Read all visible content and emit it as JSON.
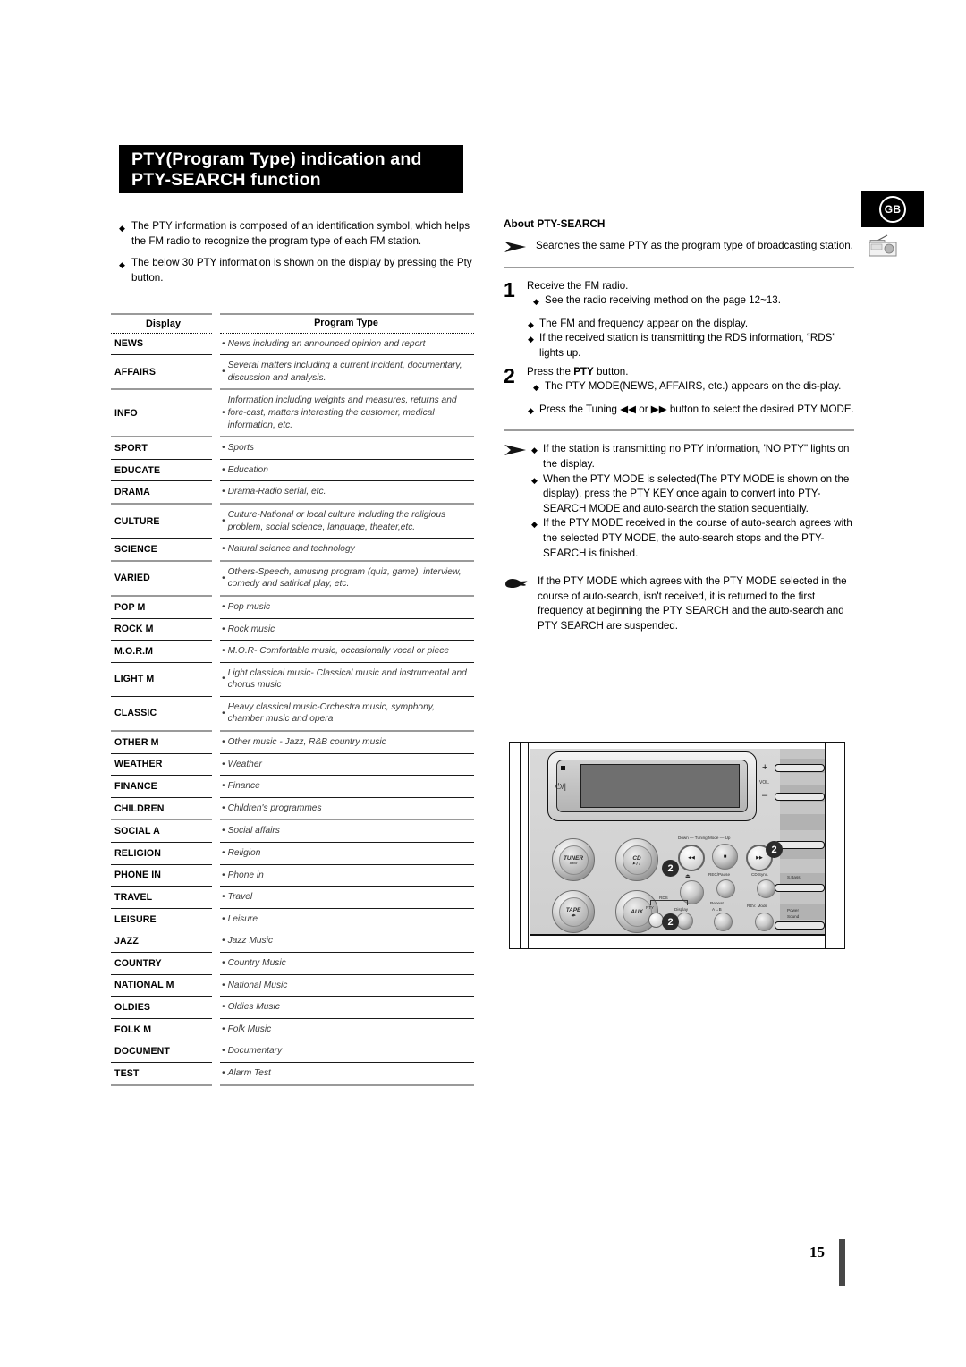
{
  "title": {
    "line1": "PTY(Program Type) indication and",
    "line2": "PTY-SEARCH function"
  },
  "badge": {
    "region": "GB"
  },
  "intro": {
    "bullet1": "The PTY information is composed of an identification symbol, which helps the FM radio to recognize the program type of each FM station.",
    "bullet2": "The below 30 PTY information is shown on the display by pressing the Pty button."
  },
  "table": {
    "headers": {
      "display": "Display",
      "program_type": "Program Type"
    },
    "rows": [
      {
        "display": "NEWS",
        "program": "News including an announced opinion and report"
      },
      {
        "display": "AFFAIRS",
        "program": "Several matters including a current incident, documentary, discussion and analysis."
      },
      {
        "display": "INFO",
        "program": "Information including weights and measures, returns and fore-cast, matters interesting the customer, medical information, etc."
      },
      {
        "display": "SPORT",
        "program": "Sports"
      },
      {
        "display": "EDUCATE",
        "program": "Education"
      },
      {
        "display": "DRAMA",
        "program": "Drama-Radio serial, etc."
      },
      {
        "display": "CULTURE",
        "program": "Culture-National or local culture including the religious problem, social science, language, theater,etc."
      },
      {
        "display": "SCIENCE",
        "program": "Natural science and technology"
      },
      {
        "display": "VARIED",
        "program": "Others-Speech, amusing program (quiz, game), interview, comedy and satirical play, etc."
      },
      {
        "display": "POP M",
        "program": "Pop music"
      },
      {
        "display": "ROCK M",
        "program": "Rock music"
      },
      {
        "display": "M.O.R.M",
        "program": "M.O.R- Comfortable music, occasionally vocal or piece"
      },
      {
        "display": "LIGHT M",
        "program": "Light classical music- Classical music and instrumental and chorus music"
      },
      {
        "display": "CLASSIC",
        "program": "Heavy classical  music-Orchestra music, symphony, chamber music and opera"
      },
      {
        "display": "OTHER M",
        "program": "Other music - Jazz, R&B country music"
      },
      {
        "display": "WEATHER",
        "program": "Weather"
      },
      {
        "display": "FINANCE",
        "program": "Finance"
      },
      {
        "display": "CHILDREN",
        "program": "Children's programmes"
      },
      {
        "display": "SOCIAL  A",
        "program": "Social affairs"
      },
      {
        "display": "RELIGION",
        "program": "Religion"
      },
      {
        "display": "PHONE IN",
        "program": "Phone in"
      },
      {
        "display": "TRAVEL",
        "program": "Travel"
      },
      {
        "display": "LEISURE",
        "program": "Leisure"
      },
      {
        "display": "JAZZ",
        "program": "Jazz Music"
      },
      {
        "display": "COUNTRY",
        "program": "Country Music"
      },
      {
        "display": "NATIONAL M",
        "program": "National Music"
      },
      {
        "display": "OLDIES",
        "program": "Oldies Music"
      },
      {
        "display": "FOLK M",
        "program": "Folk Music"
      },
      {
        "display": "DOCUMENT",
        "program": "Documentary"
      },
      {
        "display": "TEST",
        "program": "Alarm Test"
      }
    ]
  },
  "about": {
    "heading_bold": "About ",
    "heading_rest": "PTY-SEARCH",
    "note": "Searches the same PTY as the program type of broadcasting station."
  },
  "steps": [
    {
      "num": "1",
      "title": "Receive the FM radio.",
      "bullets": [
        "See the radio receiving method on the page 12~13.",
        "The FM and frequency appear on the display.",
        "If the received station is transmitting the RDS information, “RDS” lights up."
      ]
    },
    {
      "num": "2",
      "title_pre": "Press the ",
      "title_bold": "PTY",
      "title_post": " button.",
      "bullets": [
        "The PTY MODE(NEWS, AFFAIRS, etc.) appears on the dis-play.",
        "Press the Tuning ◀◀ or ▶▶ button to select the desired PTY MODE."
      ]
    }
  ],
  "notes": {
    "arrow_bullets": [
      "If the station is transmitting no PTY information, 'NO PTY\" lights on the display.",
      "When the PTY MODE is selected(The PTY MODE is shown on the display), press the PTY KEY once again to convert into PTY-SEARCH MODE and auto-search the station sequentially.",
      "If the PTY MODE received in the course of auto-search agrees with the selected PTY MODE, the auto-search stops and the PTY-SEARCH is finished."
    ],
    "hand_note": "If the PTY MODE which agrees with the PTY MODE selected in the course of auto-search, isn't received, it is returned to the first frequency at beginning the PTY SEARCH and the auto-search and PTY SEARCH are suspended."
  },
  "device": {
    "power_symbol": "⏻/|",
    "vol_label": "VOL.",
    "vol_plus": "+",
    "vol_minus": "–",
    "buttons": {
      "tuner": "TUNER",
      "tuner_sub": "Band",
      "cd": "CD",
      "cd_sub": "▶❙❙",
      "tape": "TAPE",
      "tape_sub": "◀▶",
      "aux": "AUX"
    },
    "labels": {
      "tuning_mode": "Down — Tuning Mode — Up",
      "rec_pause": "REC/Pause",
      "cd_sync": "CD Sync.",
      "repeat": "Repeat",
      "repeat_sub": "A↔B",
      "rev_mode": "REV. Mode",
      "s_bass": "S.Bass",
      "power_sound_1": "Power",
      "power_sound_2": "Sound",
      "rds": "RDS",
      "pty": "PTY",
      "display": "Display",
      "stop": "■",
      "skip_back": "◀◀",
      "skip_fwd": "▶▶",
      "eject": "⏏"
    },
    "callouts": [
      "2",
      "2",
      "2"
    ]
  },
  "footer": {
    "page_number": "15"
  }
}
